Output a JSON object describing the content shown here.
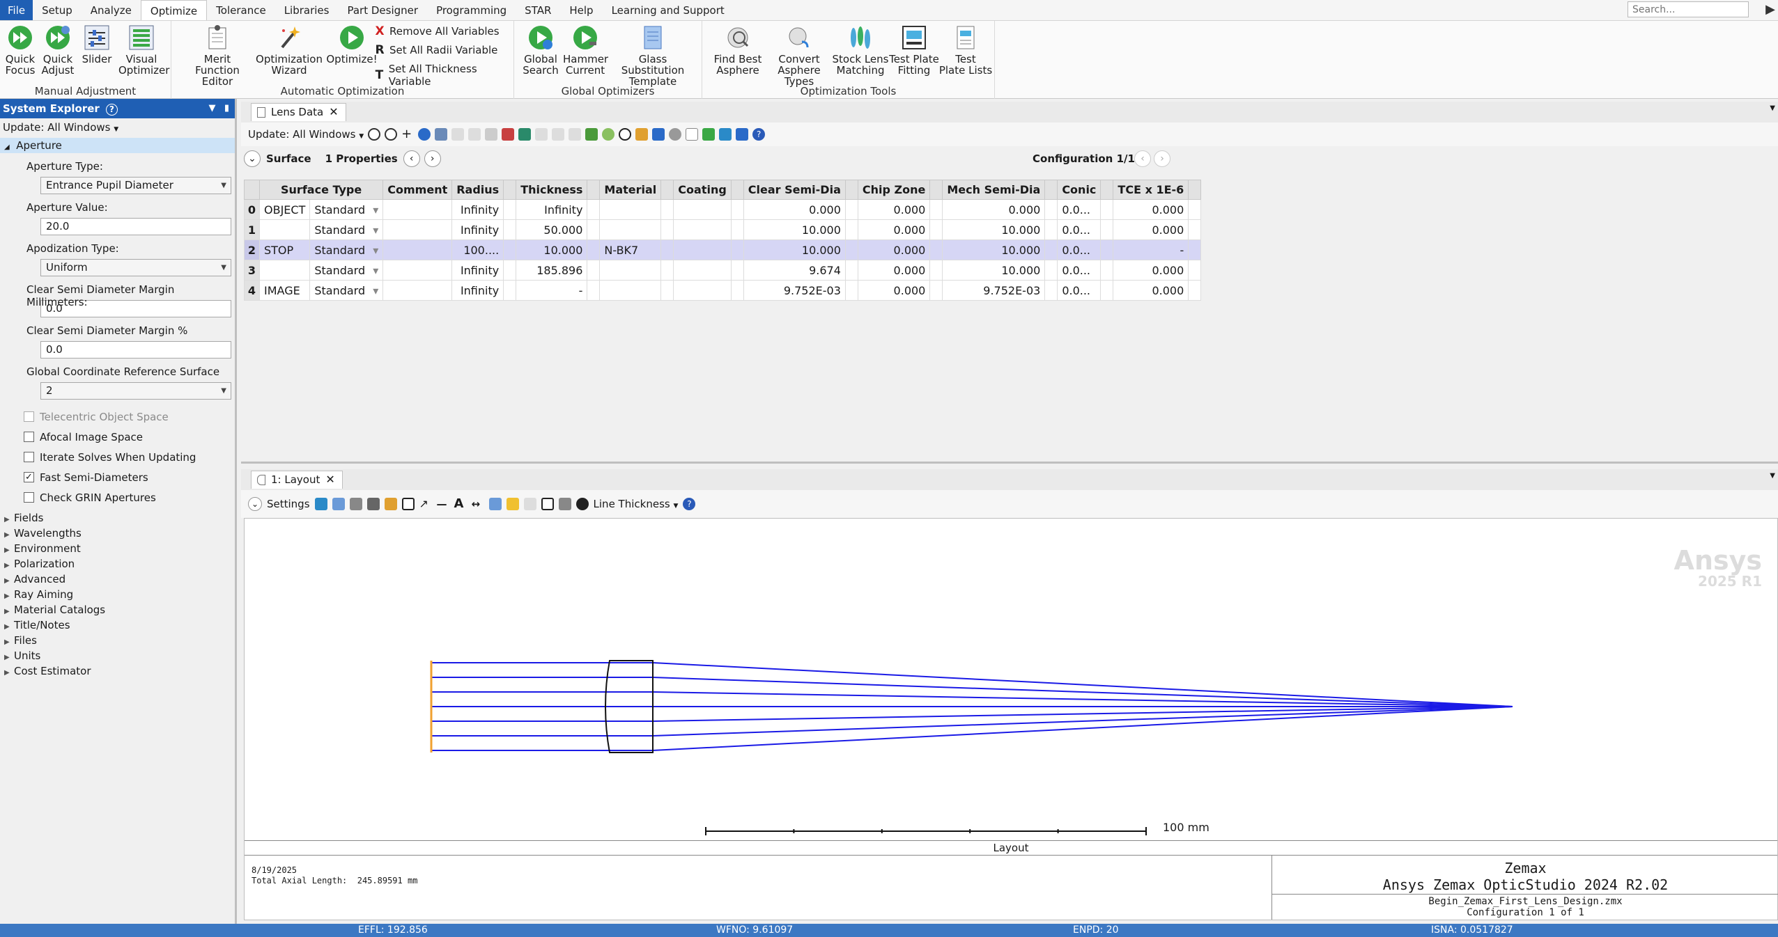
{
  "menu": [
    "File",
    "Setup",
    "Analyze",
    "Optimize",
    "Tolerance",
    "Libraries",
    "Part Designer",
    "Programming",
    "STAR",
    "Help",
    "Learning and Support"
  ],
  "search_placeholder": "Search...",
  "ribbon": {
    "manual": {
      "label": "Manual Adjustment",
      "buttons": [
        {
          "l1": "Quick",
          "l2": "Focus"
        },
        {
          "l1": "Quick",
          "l2": "Adjust"
        },
        {
          "l1": "Slider",
          "l2": ""
        },
        {
          "l1": "Visual",
          "l2": "Optimizer"
        }
      ]
    },
    "auto": {
      "label": "Automatic Optimization",
      "buttons": [
        {
          "l1": "Merit",
          "l2": "Function Editor"
        },
        {
          "l1": "Optimization",
          "l2": "Wizard"
        },
        {
          "l1": "Optimize!",
          "l2": ""
        }
      ],
      "small": [
        "Remove All Variables",
        "Set All Radii Variable",
        "Set All Thickness Variable"
      ]
    },
    "global": {
      "label": "Global Optimizers",
      "buttons": [
        {
          "l1": "Global",
          "l2": "Search"
        },
        {
          "l1": "Hammer",
          "l2": "Current"
        },
        {
          "l1": "Glass Substitution",
          "l2": "Template"
        }
      ]
    },
    "tools": {
      "label": "Optimization Tools",
      "buttons": [
        {
          "l1": "Find Best",
          "l2": "Asphere"
        },
        {
          "l1": "Convert",
          "l2": "Asphere Types"
        },
        {
          "l1": "Stock Lens",
          "l2": "Matching"
        },
        {
          "l1": "Test Plate",
          "l2": "Fitting"
        },
        {
          "l1": "Test",
          "l2": "Plate Lists"
        }
      ]
    }
  },
  "system_explorer": {
    "title": "System Explorer",
    "update": "Update: All Windows",
    "section": "Aperture",
    "aperture_type_label": "Aperture Type:",
    "aperture_type": "Entrance Pupil Diameter",
    "aperture_value_label": "Aperture Value:",
    "aperture_value": "20.0",
    "apodization_label": "Apodization Type:",
    "apodization": "Uniform",
    "csd_mm_label": "Clear Semi Diameter Margin Millimeters:",
    "csd_mm": "0.0",
    "csd_pct_label": "Clear Semi Diameter Margin %",
    "csd_pct": "0.0",
    "gcrs_label": "Global Coordinate Reference Surface",
    "gcrs": "2",
    "checks": [
      {
        "label": "Telecentric Object Space",
        "checked": false,
        "disabled": true
      },
      {
        "label": "Afocal Image Space",
        "checked": false,
        "disabled": false
      },
      {
        "label": "Iterate Solves When Updating",
        "checked": false,
        "disabled": false
      },
      {
        "label": "Fast Semi-Diameters",
        "checked": true,
        "disabled": false
      },
      {
        "label": "Check GRIN Apertures",
        "checked": false,
        "disabled": false
      }
    ],
    "tree": [
      "Fields",
      "Wavelengths",
      "Environment",
      "Polarization",
      "Advanced",
      "Ray Aiming",
      "Material Catalogs",
      "Title/Notes",
      "Files",
      "Units",
      "Cost Estimator"
    ]
  },
  "lens_data": {
    "tab": "Lens Data",
    "update": "Update: All Windows",
    "surface_label": "Surface",
    "properties": "1 Properties",
    "configuration": "Configuration 1/1",
    "columns": [
      "",
      "Surface Type",
      "",
      "Comment",
      "Radius",
      "",
      "Thickness",
      "",
      "Material",
      "",
      "Coating",
      "",
      "Clear Semi-Dia",
      "",
      "Chip Zone",
      "",
      "Mech Semi-Dia",
      "",
      "Conic",
      "",
      "TCE x 1E-6",
      ""
    ],
    "rows": [
      [
        "0",
        "OBJECT",
        "Standard",
        "",
        "Infinity",
        "Infinity",
        "",
        "",
        "0.000",
        "0.000",
        "0.000",
        "0.0...",
        "0.000"
      ],
      [
        "1",
        "",
        "Standard",
        "",
        "Infinity",
        "50.000",
        "",
        "",
        "10.000",
        "0.000",
        "10.000",
        "0.0...",
        "0.000"
      ],
      [
        "2",
        "STOP",
        "Standard",
        "",
        "100....",
        "10.000",
        "N-BK7",
        "",
        "10.000",
        "0.000",
        "10.000",
        "0.0...",
        "-"
      ],
      [
        "3",
        "",
        "Standard",
        "",
        "Infinity",
        "185.896",
        "",
        "",
        "9.674",
        "0.000",
        "10.000",
        "0.0...",
        "0.000"
      ],
      [
        "4",
        "IMAGE",
        "Standard",
        "",
        "Infinity",
        "-",
        "",
        "",
        "9.752E-03",
        "0.000",
        "9.752E-03",
        "0.0...",
        "0.000"
      ]
    ]
  },
  "layout": {
    "tab": "1: Layout",
    "settings": "Settings",
    "line_thickness": "Line Thickness",
    "watermark": "Ansys",
    "watermark_version": "2025 R1",
    "scale_label": "100 mm",
    "caption": "Layout",
    "date": "8/19/2025",
    "axial_length": "Total Axial Length:  245.89591 mm",
    "brand1": "Zemax",
    "brand2": "Ansys Zemax OpticStudio 2024 R2.02",
    "file": "Begin_Zemax_First_Lens_Design.zmx",
    "config": "Configuration 1 of 1",
    "ray_color": "#1a1ae6",
    "object_color": "#f0a030"
  },
  "status": {
    "effl": "EFFL: 192.856",
    "wfno": "WFNO: 9.61097",
    "enpd": "ENPD: 20",
    "isna": "ISNA: 0.0517827"
  }
}
